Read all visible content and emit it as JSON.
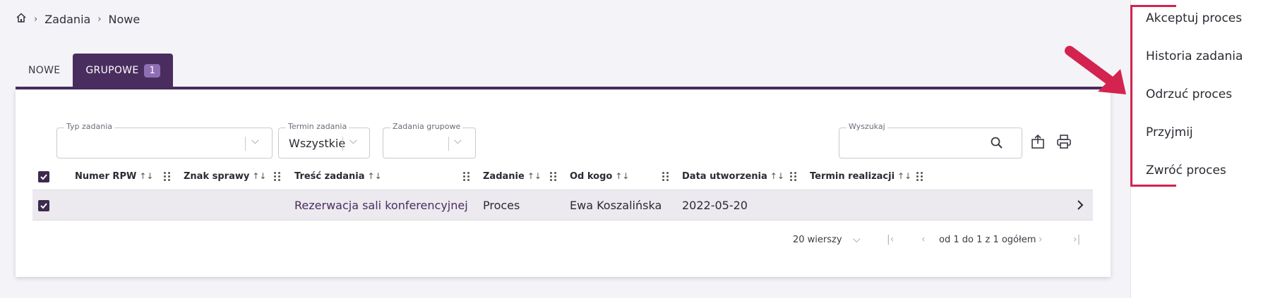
{
  "breadcrumb": {
    "home_icon": "home-icon",
    "items": [
      "Zadania",
      "Nowe"
    ]
  },
  "tabs": [
    {
      "label": "NOWE"
    },
    {
      "label": "GRUPOWE",
      "badge": "1"
    }
  ],
  "filters": {
    "typ_zadania": {
      "label": "Typ zadania",
      "value": ""
    },
    "termin_zadania": {
      "label": "Termin zadania",
      "value": "Wszystkie"
    },
    "zadania_grupowe": {
      "label": "Zadania grupowe",
      "value": ""
    },
    "search": {
      "label": "Wyszukaj",
      "value": ""
    }
  },
  "table": {
    "columns": [
      "Numer RPW",
      "Znak sprawy",
      "Treść zadania",
      "Zadanie",
      "Od kogo",
      "Data utworzenia",
      "Termin realizacji"
    ],
    "sort_glyph": "↑↓",
    "rows": [
      {
        "numer_rpw": "",
        "znak_sprawy": "",
        "tresc": "Rezerwacja sali konferencyjnej",
        "zadanie": "Proces",
        "od_kogo": "Ewa Koszalińska",
        "data": "2022-05-20",
        "termin": ""
      }
    ]
  },
  "pagination": {
    "rows_per_page": "20 wierszy",
    "range": "od 1 do 1 z 1 ogółem"
  },
  "side_menu": [
    "Akceptuj proces",
    "Historia zadania",
    "Odrzuć proces",
    "Przyjmij",
    "Zwróć proces"
  ],
  "colors": {
    "accent": "#4a2d5f",
    "badge": "#8e6fb3",
    "highlight": "#d3234e"
  }
}
